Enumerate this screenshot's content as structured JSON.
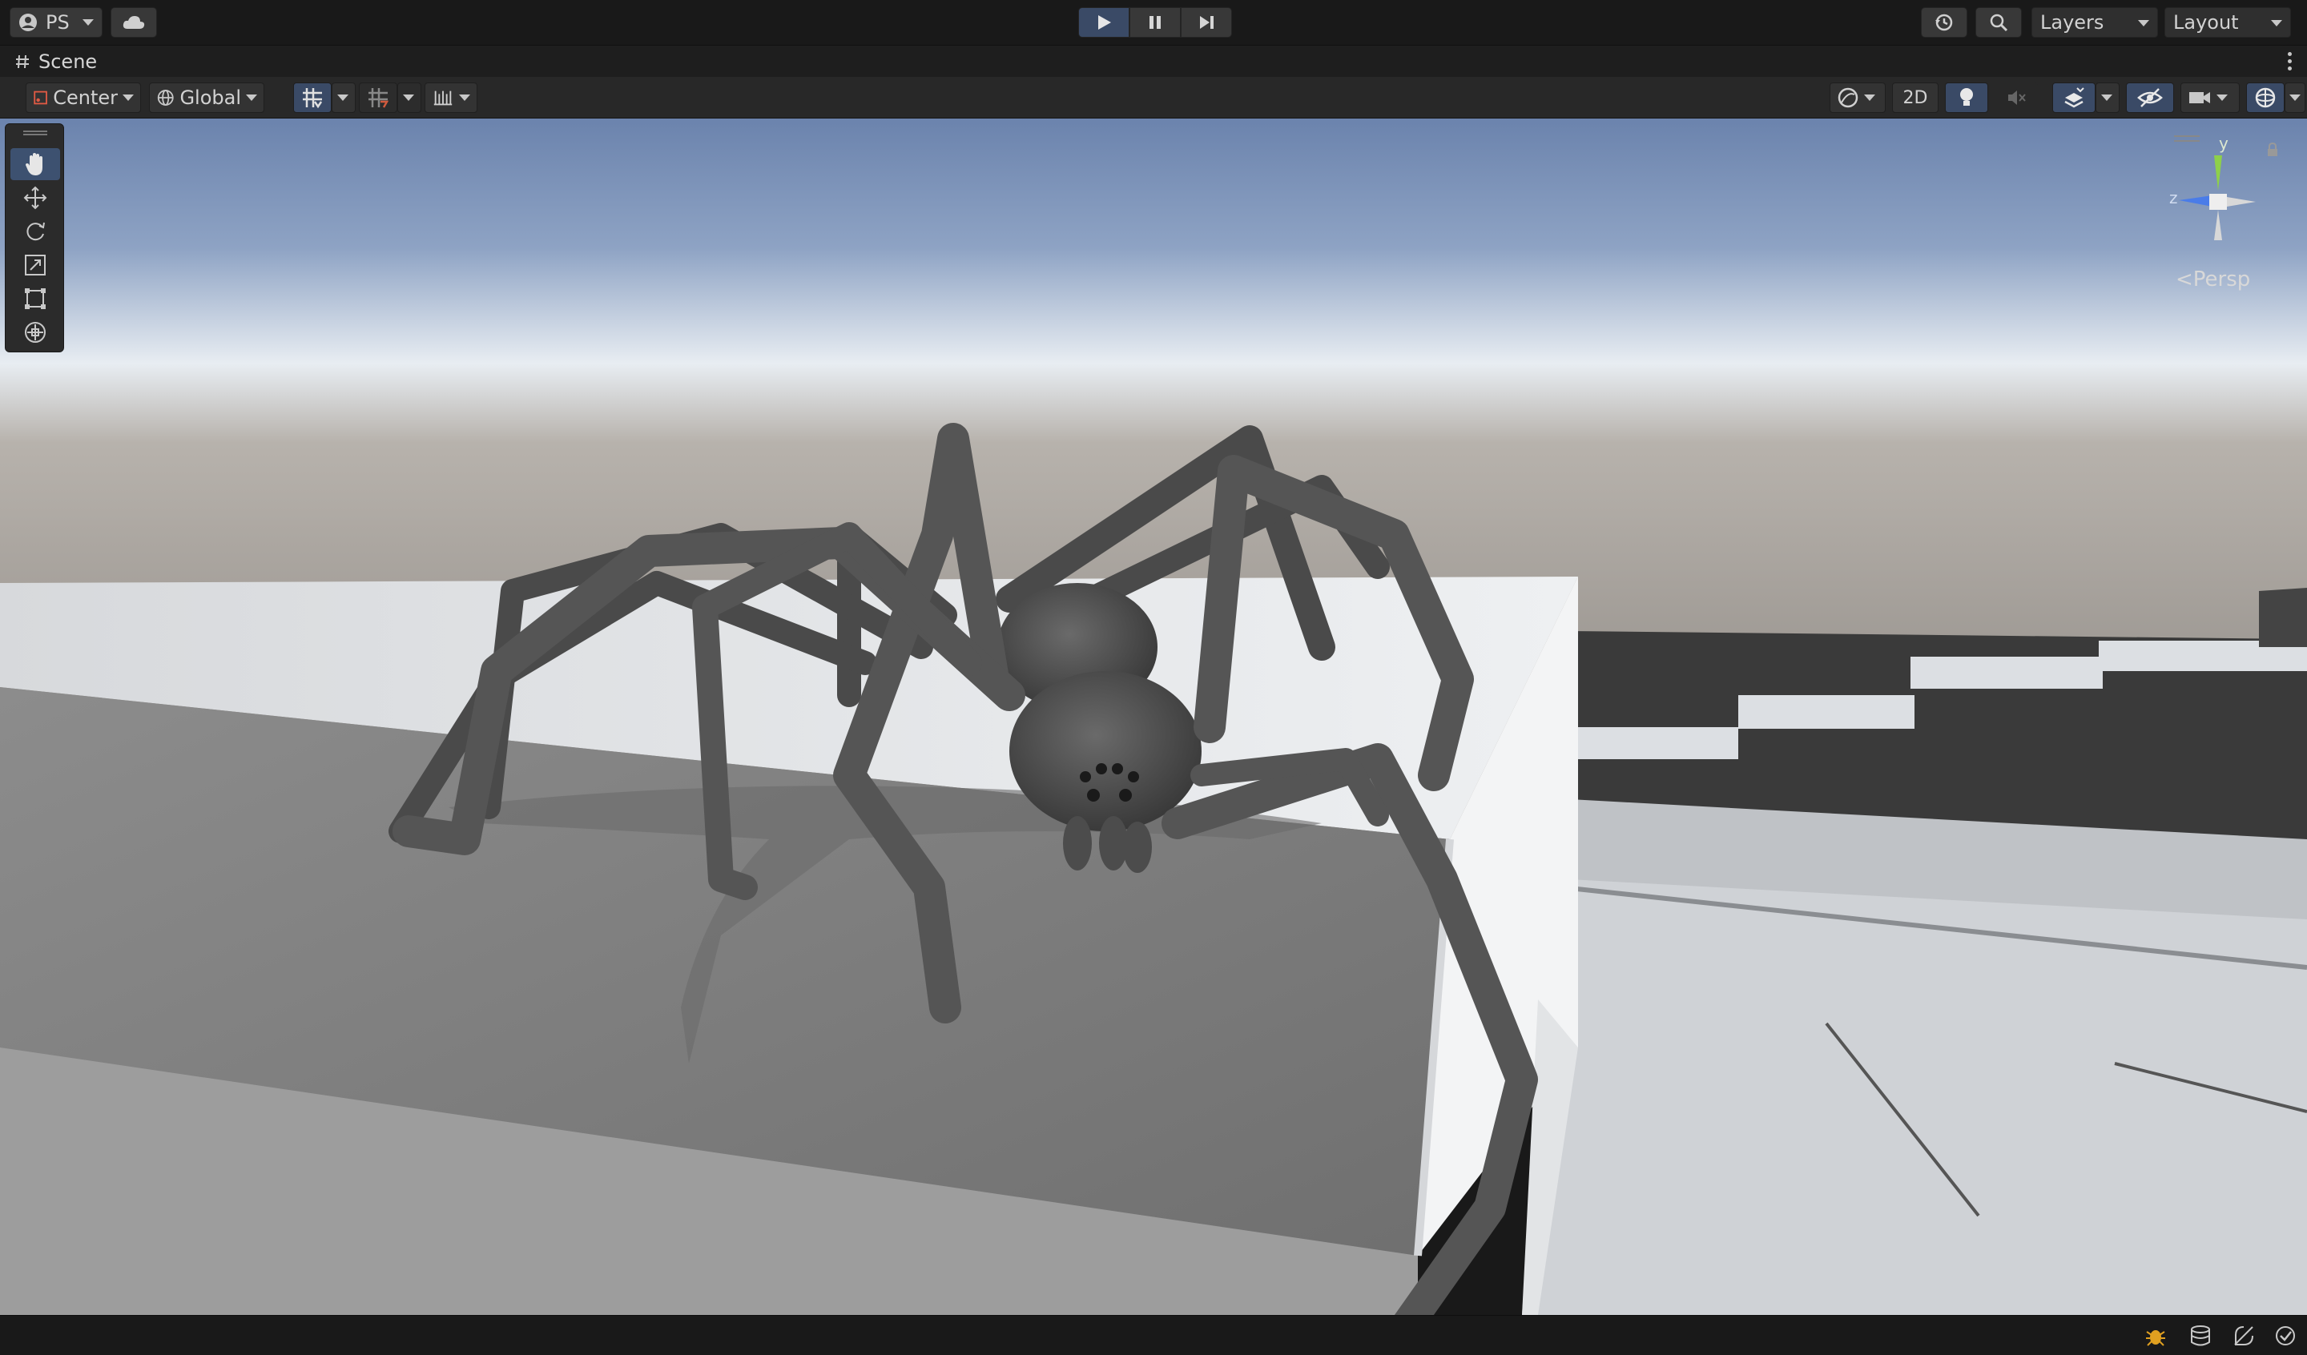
{
  "topbar": {
    "account_label": "PS",
    "layers_label": "Layers",
    "layout_label": "Layout",
    "icons": [
      "account-icon",
      "cloud-icon",
      "play-icon",
      "pause-icon",
      "step-icon",
      "history-icon",
      "search-icon"
    ]
  },
  "scene_tab": {
    "title": "Scene",
    "icon": "hash-icon"
  },
  "scene_toolbar": {
    "pivot_label": "Center",
    "space_label": "Global",
    "mode_2d_label": "2D"
  },
  "tools": [
    "hand-tool",
    "move-tool",
    "rotate-tool",
    "scale-tool",
    "rect-tool",
    "transform-tool"
  ],
  "gizmo": {
    "projection_label": "Persp",
    "y_label": "y",
    "z_label": "z"
  },
  "colors": {
    "accent": "#3d5170",
    "gizmo_y": "#8ed04a",
    "gizmo_z": "#4a7ce8",
    "sky_top": "#6b83ad",
    "sky_horizon": "#e8edf2"
  },
  "statusbar": {
    "icons": [
      "bug-icon",
      "cache-icon",
      "auto-generate-icon",
      "checkmark-icon"
    ]
  }
}
